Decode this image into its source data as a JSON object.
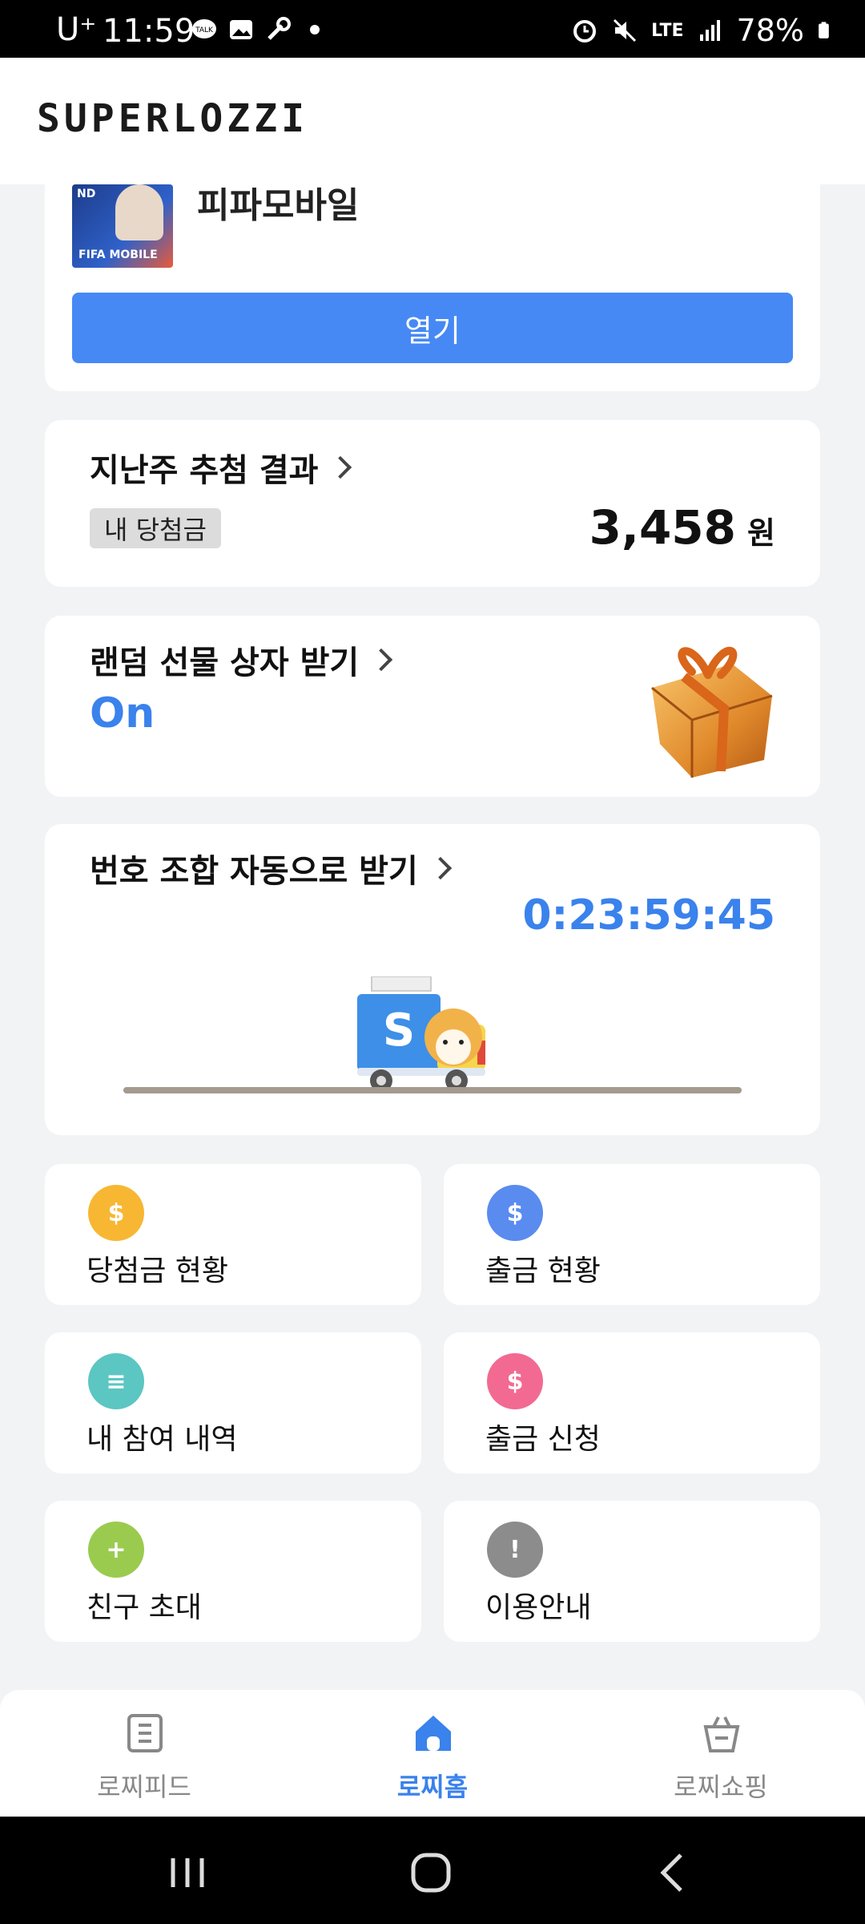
{
  "status_bar": {
    "carrier": "U⁺",
    "time": "11:59",
    "battery": "78%",
    "network": "LTE"
  },
  "header": {
    "logo": "SUPERLOZZI"
  },
  "game_card": {
    "title": "피파모바일",
    "thumb_badge": "ND",
    "thumb_brand": "FIFA MOBILE",
    "open_button": "열기"
  },
  "result_card": {
    "title": "지난주 추첨 결과",
    "badge": "내 당첨금",
    "amount": "3,458",
    "unit": "원"
  },
  "gift_card": {
    "title": "랜덤 선물 상자 받기",
    "status": "On"
  },
  "auto_card": {
    "title": "번호 조합 자동으로 받기",
    "timer": "0:23:59:45"
  },
  "menu": [
    {
      "label": "당첨금 현황",
      "icon": "wallet-icon",
      "color": "#f7b733",
      "glyph": "$"
    },
    {
      "label": "출금 현황",
      "icon": "atm-icon",
      "color": "#5a8bef",
      "glyph": "$"
    },
    {
      "label": "내 참여 내역",
      "icon": "ticket-icon",
      "color": "#5cc6c2",
      "glyph": "≡"
    },
    {
      "label": "출금 신청",
      "icon": "withdraw-request-icon",
      "color": "#f26a92",
      "glyph": "$"
    },
    {
      "label": "친구 초대",
      "icon": "add-friend-icon",
      "color": "#9acb4f",
      "glyph": "+"
    },
    {
      "label": "이용안내",
      "icon": "warning-icon",
      "color": "#8c8c8c",
      "glyph": "!"
    }
  ],
  "bottom_nav": {
    "items": [
      {
        "label": "로찌피드",
        "icon": "feed-icon"
      },
      {
        "label": "로찌홈",
        "icon": "home-icon"
      },
      {
        "label": "로찌쇼핑",
        "icon": "shopping-bag-icon"
      }
    ],
    "active_index": 1
  },
  "colors": {
    "accent": "#3a82ec",
    "button": "#4689f5"
  }
}
